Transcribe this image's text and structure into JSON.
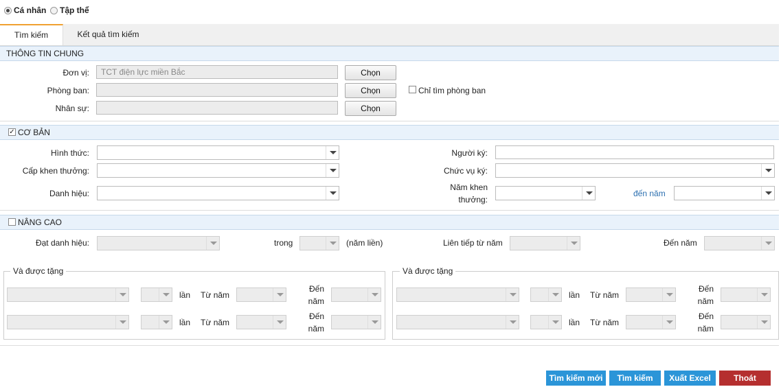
{
  "mode": {
    "individual": "Cá nhân",
    "group": "Tập thể"
  },
  "tabs": {
    "search": "Tìm kiếm",
    "results": "Kết quả tìm kiếm"
  },
  "general": {
    "title": "THÔNG TIN CHUNG",
    "unit_label": "Đơn vị:",
    "unit_value": "TCT điện lực miền Bắc",
    "dept_label": "Phòng ban:",
    "staff_label": "Nhân sự:",
    "choose": "Chọn",
    "dept_only": "Chỉ tìm phòng ban"
  },
  "basic": {
    "title": "CƠ BẢN",
    "form_label": "Hình thức:",
    "level_label": "Cấp khen thưởng:",
    "title_label": "Danh hiệu:",
    "signer_label": "Người ký:",
    "position_label": "Chức vụ ký:",
    "year_label_1": "Năm khen",
    "year_label_2": "thưởng:",
    "to_year": "đến năm"
  },
  "advanced": {
    "title": "NÂNG CAO",
    "achieved_label": "Đạt danh hiệu:",
    "within": "trong",
    "consecutive": "(năm liền)",
    "streak_from": "Liên tiếp từ năm",
    "to_year": "Đến năm",
    "awarded_legend": "Và được tặng",
    "times": "lần",
    "from_year": "Từ năm",
    "to_1": "Đến",
    "to_2": "năm"
  },
  "actions": {
    "new_search": "Tìm kiếm mới",
    "search": "Tìm kiếm",
    "export": "Xuất Excel",
    "exit": "Thoát"
  },
  "colors": {
    "action_blue": "#2b95d8",
    "exit_red": "#b52f2f",
    "tab_accent": "#f0a030"
  }
}
